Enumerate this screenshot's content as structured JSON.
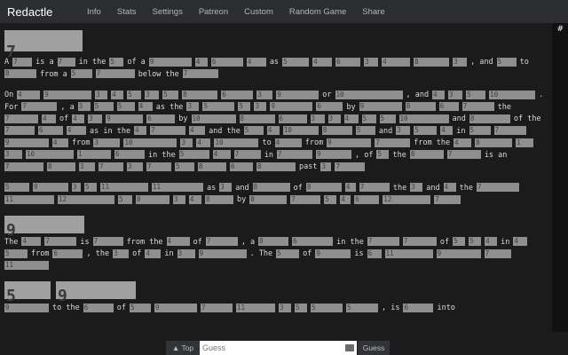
{
  "nav": {
    "brand": "Redactle",
    "items": [
      "Info",
      "Stats",
      "Settings",
      "Patreon",
      "Custom",
      "Random Game",
      "Share"
    ]
  },
  "scroll_pin": "#",
  "title_blocks": [
    "7"
  ],
  "sections": [
    {
      "heading": [
        "9"
      ]
    },
    {
      "heading": [
        "5",
        "9"
      ]
    }
  ],
  "paragraphs": [
    [
      [
        "w",
        "A"
      ],
      [
        "b",
        "7",
        22
      ],
      [
        "w",
        "is a"
      ],
      [
        "b",
        "7",
        20
      ],
      [
        "w",
        "in the"
      ],
      [
        "b",
        "5",
        16
      ],
      [
        "w",
        "of a"
      ],
      [
        "b",
        "9",
        48
      ],
      [
        "b",
        "4",
        14
      ],
      [
        "b",
        "6",
        36
      ],
      [
        "b",
        "4",
        22
      ],
      [
        "w",
        "as"
      ],
      [
        "b",
        "5",
        30
      ],
      [
        "b",
        "4",
        22
      ],
      [
        "b",
        "6",
        28
      ],
      [
        "b",
        "3",
        16
      ],
      [
        "b",
        "4",
        32
      ],
      [
        "b",
        "8",
        40
      ],
      [
        "b",
        "3",
        16
      ],
      [
        "w",
        ", and"
      ],
      [
        "b",
        "5",
        22
      ],
      [
        "w",
        "to"
      ],
      [
        "b",
        "8",
        36
      ],
      [
        "w",
        "from a"
      ],
      [
        "b",
        "5",
        24
      ],
      [
        "b",
        "7",
        44
      ],
      [
        "w",
        "below the"
      ],
      [
        "b",
        "7",
        40
      ]
    ],
    [
      [
        "w",
        "On"
      ],
      [
        "b",
        "4",
        26
      ],
      [
        "b",
        "9",
        54
      ],
      [
        "b",
        "3",
        14
      ],
      [
        "b",
        "4",
        14
      ],
      [
        "b",
        "5",
        16
      ],
      [
        "b",
        "3",
        16
      ],
      [
        "b",
        "5",
        18
      ],
      [
        "b",
        "8",
        40
      ],
      [
        "b",
        "6",
        36
      ],
      [
        "b",
        "3",
        18
      ],
      [
        "b",
        "9",
        48
      ],
      [
        "w",
        "or"
      ],
      [
        "b",
        "10",
        76
      ],
      [
        "w",
        ", and"
      ],
      [
        "b",
        "4",
        14
      ],
      [
        "b",
        "3",
        16
      ],
      [
        "b",
        "5",
        22
      ],
      [
        "b",
        "10",
        52
      ],
      [
        "w",
        ". For"
      ],
      [
        "b",
        "7",
        40
      ],
      [
        "w",
        ", a"
      ],
      [
        "b",
        "3",
        14
      ],
      [
        "b",
        "5",
        22
      ],
      [
        "b",
        "5",
        20
      ],
      [
        "b",
        "4",
        16
      ],
      [
        "w",
        "as the"
      ],
      [
        "b",
        "3",
        14
      ],
      [
        "b",
        "5",
        36
      ],
      [
        "b",
        "5",
        14
      ],
      [
        "b",
        "3",
        14
      ],
      [
        "b",
        "9",
        48
      ],
      [
        "b",
        "6",
        30
      ],
      [
        "w",
        "by"
      ],
      [
        "b",
        "9",
        48
      ],
      [
        "b",
        "8",
        34
      ],
      [
        "b",
        "6",
        22
      ],
      [
        "b",
        "7",
        36
      ],
      [
        "w",
        "the"
      ],
      [
        "b",
        "7",
        38
      ],
      [
        "b",
        "4",
        16
      ],
      [
        "w",
        "of"
      ],
      [
        "b",
        "4",
        14
      ],
      [
        "b",
        "3",
        16
      ],
      [
        "b",
        "9",
        42
      ],
      [
        "b",
        "6",
        32
      ],
      [
        "w",
        "by"
      ],
      [
        "b",
        "10",
        50
      ],
      [
        "b",
        "8",
        40
      ],
      [
        "b",
        "6",
        32
      ],
      [
        "b",
        "3",
        16
      ],
      [
        "b",
        "3",
        14
      ],
      [
        "b",
        "4",
        16
      ],
      [
        "b",
        "5",
        16
      ],
      [
        "b",
        "5",
        18
      ],
      [
        "b",
        "10",
        56
      ],
      [
        "w",
        "and"
      ],
      [
        "b",
        "8",
        46
      ],
      [
        "w",
        "of the"
      ],
      [
        "b",
        "7",
        34
      ],
      [
        "b",
        "6",
        28
      ],
      [
        "b",
        "4",
        22
      ],
      [
        "w",
        "as in the"
      ],
      [
        "b",
        "4",
        14
      ],
      [
        "b",
        "7",
        40
      ],
      [
        "b",
        "4",
        18
      ],
      [
        "w",
        "and the"
      ],
      [
        "b",
        "5",
        22
      ],
      [
        "b",
        "4",
        14
      ],
      [
        "b",
        "10",
        40
      ],
      [
        "b",
        "8",
        34
      ],
      [
        "b",
        "5",
        22
      ],
      [
        "w",
        "and"
      ],
      [
        "b",
        "3",
        16
      ],
      [
        "b",
        "5",
        26
      ],
      [
        "b",
        "4",
        14
      ],
      [
        "w",
        "in"
      ],
      [
        "b",
        "5",
        24
      ],
      [
        "b",
        "7",
        36
      ],
      [
        "b",
        "9",
        50
      ],
      [
        "b",
        "4",
        18
      ],
      [
        "w",
        "from"
      ],
      [
        "b",
        "3",
        30
      ],
      [
        "b",
        "10",
        60
      ],
      [
        "b",
        "3",
        14
      ],
      [
        "b",
        "4",
        16
      ],
      [
        "b",
        "10",
        50
      ],
      [
        "w",
        "to"
      ],
      [
        "b",
        "4",
        30
      ],
      [
        "w",
        "from"
      ],
      [
        "b",
        "9",
        50
      ],
      [
        "b",
        "7",
        40
      ],
      [
        "w",
        "from the"
      ],
      [
        "b",
        "4",
        20
      ],
      [
        "b",
        "8",
        42
      ],
      [
        "b",
        "1",
        20
      ],
      [
        "b",
        "3",
        20
      ],
      [
        "b",
        "10",
        54
      ],
      [
        "b",
        "1",
        38
      ],
      [
        "b",
        "6",
        34
      ],
      [
        "w",
        "in the"
      ],
      [
        "b",
        "5",
        34
      ],
      [
        "b",
        "4",
        20
      ],
      [
        "b",
        "7",
        30
      ],
      [
        "w",
        "in"
      ],
      [
        "b",
        "7",
        40
      ],
      [
        "b",
        "9",
        40
      ],
      [
        "w",
        ", of"
      ],
      [
        "b",
        "5",
        14
      ],
      [
        "w",
        "the"
      ],
      [
        "b",
        "8",
        38
      ],
      [
        "b",
        "7",
        38
      ],
      [
        "w",
        "is an"
      ],
      [
        "b",
        "7",
        44
      ],
      [
        "b",
        "8",
        32
      ],
      [
        "b",
        "3",
        18
      ],
      [
        "b",
        "7",
        28
      ],
      [
        "b",
        "3",
        18
      ],
      [
        "b",
        "7",
        28
      ],
      [
        "b",
        "5",
        22
      ],
      [
        "b",
        "8",
        32
      ],
      [
        "b",
        "6",
        26
      ],
      [
        "b",
        "8",
        44
      ],
      [
        "w",
        "past"
      ],
      [
        "b",
        "3",
        12
      ],
      [
        "b",
        "7",
        34
      ]
    ],
    [
      [
        "b",
        "5",
        28
      ],
      [
        "b",
        "9",
        40
      ],
      [
        "b",
        "3",
        10
      ],
      [
        "b",
        "5",
        14
      ],
      [
        "b",
        "11",
        54
      ],
      [
        "b",
        "11",
        58
      ],
      [
        "w",
        "as"
      ],
      [
        "b",
        "3",
        14
      ],
      [
        "w",
        "and"
      ],
      [
        "b",
        "8",
        42
      ],
      [
        "w",
        "of"
      ],
      [
        "b",
        "8",
        40
      ],
      [
        "b",
        "4",
        12
      ],
      [
        "b",
        "7",
        34
      ],
      [
        "w",
        "the"
      ],
      [
        "b",
        "3",
        14
      ],
      [
        "w",
        "and"
      ],
      [
        "b",
        "4",
        14
      ],
      [
        "w",
        "the"
      ],
      [
        "b",
        "7",
        48
      ],
      [
        "b",
        "11",
        56
      ],
      [
        "b",
        "12",
        64
      ],
      [
        "b",
        "5",
        16
      ],
      [
        "b",
        "8",
        38
      ],
      [
        "b",
        "3",
        14
      ],
      [
        "b",
        "4",
        14
      ],
      [
        "b",
        "8",
        32
      ],
      [
        "w",
        "by"
      ],
      [
        "b",
        "8",
        42
      ],
      [
        "b",
        "7",
        34
      ],
      [
        "b",
        "5",
        14
      ],
      [
        "b",
        "4",
        12
      ],
      [
        "b",
        "6",
        28
      ],
      [
        "b",
        "12",
        54
      ],
      [
        "b",
        "7",
        30
      ]
    ],
    [
      [
        "w",
        "The"
      ],
      [
        "b",
        "4",
        22
      ],
      [
        "b",
        "7",
        36
      ],
      [
        "w",
        "is"
      ],
      [
        "b",
        "7",
        34
      ],
      [
        "w",
        "from the"
      ],
      [
        "b",
        "4",
        26
      ],
      [
        "w",
        "of"
      ],
      [
        "b",
        "7",
        36
      ],
      [
        "w",
        ", a"
      ],
      [
        "b",
        "8",
        34
      ],
      [
        "b",
        "6",
        46
      ],
      [
        "w",
        "in the"
      ],
      [
        "b",
        "7",
        36
      ],
      [
        "b",
        "7",
        38
      ],
      [
        "w",
        "of"
      ],
      [
        "b",
        "5",
        14
      ],
      [
        "b",
        "5",
        14
      ],
      [
        "b",
        "4",
        14
      ],
      [
        "w",
        "in"
      ],
      [
        "b",
        "4",
        16
      ],
      [
        "b",
        "5",
        26
      ],
      [
        "w",
        "from"
      ],
      [
        "b",
        "6",
        34
      ],
      [
        "w",
        ", the"
      ],
      [
        "b",
        "3",
        18
      ],
      [
        "w",
        "of"
      ],
      [
        "b",
        "4",
        18
      ],
      [
        "w",
        "in"
      ],
      [
        "b",
        "3",
        20
      ],
      [
        "b",
        "9",
        54
      ],
      [
        "w",
        ". The"
      ],
      [
        "b",
        "5",
        26
      ],
      [
        "w",
        "of"
      ],
      [
        "b",
        "9",
        40
      ],
      [
        "w",
        "is"
      ],
      [
        "b",
        "6",
        16
      ],
      [
        "b",
        "11",
        54
      ],
      [
        "b",
        "9",
        50
      ],
      [
        "b",
        "7",
        30
      ],
      [
        "b",
        "11",
        50
      ]
    ],
    [
      [
        "b",
        "9",
        50
      ],
      [
        "w",
        "to the"
      ],
      [
        "b",
        "6",
        34
      ],
      [
        "w",
        "of"
      ],
      [
        "b",
        "5",
        24
      ],
      [
        "b",
        "9",
        48
      ],
      [
        "b",
        "7",
        36
      ],
      [
        "b",
        "11",
        44
      ],
      [
        "b",
        "3",
        14
      ],
      [
        "b",
        "5",
        14
      ],
      [
        "b",
        "5",
        36
      ],
      [
        "b",
        "5",
        36
      ],
      [
        "w",
        ", is"
      ],
      [
        "b",
        "6",
        34
      ],
      [
        "w",
        "into"
      ]
    ]
  ],
  "bottom": {
    "top_label": "▲ Top",
    "guess_placeholder": "Guess",
    "guess_label": "Guess"
  }
}
